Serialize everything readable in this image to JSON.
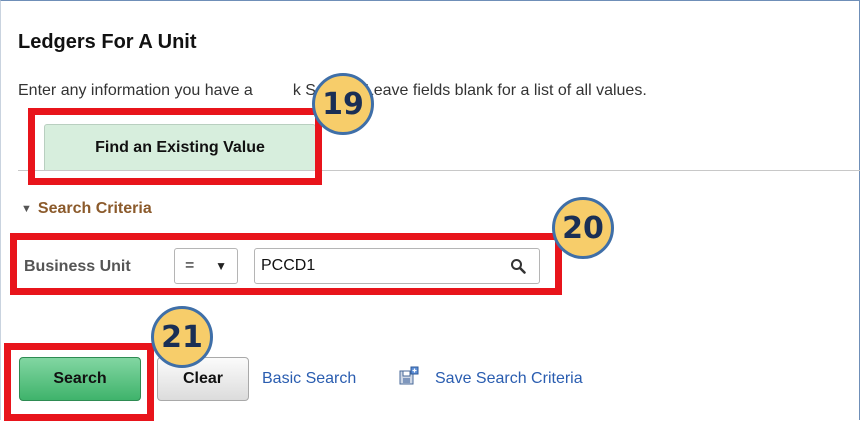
{
  "page": {
    "title": "Ledgers For A Unit",
    "instructions_left": "Enter any information you have a",
    "instructions_right": "k Search. Leave fields blank for a list of all values."
  },
  "tabs": [
    {
      "label": "Find an Existing Value",
      "active": true
    }
  ],
  "search_criteria": {
    "toggle_label": "Search Criteria",
    "expanded": true,
    "fields": [
      {
        "label": "Business Unit",
        "operator": "=",
        "value": "PCCD1",
        "lookup_icon": "search-icon"
      }
    ]
  },
  "actions": {
    "search_label": "Search",
    "clear_label": "Clear",
    "basic_search_label": "Basic Search",
    "save_search_icon": "save-search-icon",
    "save_search_label": "Save Search Criteria"
  },
  "callouts": [
    {
      "number": "19"
    },
    {
      "number": "20"
    },
    {
      "number": "21"
    }
  ],
  "colors": {
    "callout_border": "#e8141b",
    "badge_fill": "#f7cd6a",
    "badge_border": "#3f6fa8",
    "search_button": "#3fb36b",
    "link": "#2a5db0",
    "criteria_heading": "#8b5a2b",
    "tab_bg": "#d7eedd"
  }
}
